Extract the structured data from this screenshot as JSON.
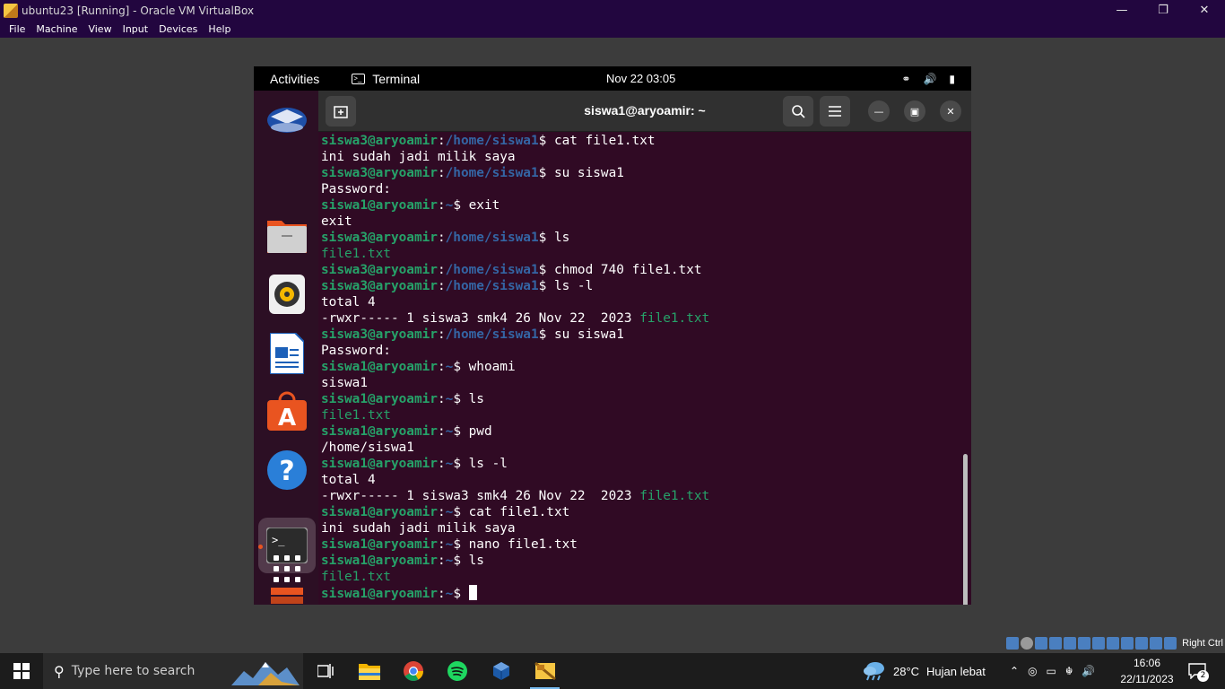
{
  "vbox": {
    "title": "ubuntu23 [Running] - Oracle VM VirtualBox",
    "menu": [
      "File",
      "Machine",
      "View",
      "Input",
      "Devices",
      "Help"
    ],
    "host_key": "Right Ctrl"
  },
  "gnome": {
    "activities": "Activities",
    "app_name": "Terminal",
    "clock": "Nov 22  03:05"
  },
  "dock": {
    "items": [
      "thunderbird-icon",
      "files-icon",
      "rhythmbox-icon",
      "libreoffice-writer-icon",
      "app-center-icon",
      "help-icon",
      "terminal-icon",
      "disk-icon",
      "show-apps-icon"
    ]
  },
  "terminal": {
    "title": "siswa1@aryoamir: ~",
    "lines": [
      {
        "user": "siswa3@aryoamir",
        "path": "/home/siswa1",
        "cmd": "cat file1.txt"
      },
      {
        "out": "ini sudah jadi milik saya"
      },
      {
        "user": "siswa3@aryoamir",
        "path": "/home/siswa1",
        "cmd": "su siswa1"
      },
      {
        "out": "Password:"
      },
      {
        "user": "siswa1@aryoamir",
        "path": "~",
        "cmd": "exit"
      },
      {
        "out": "exit"
      },
      {
        "user": "siswa3@aryoamir",
        "path": "/home/siswa1",
        "cmd": "ls"
      },
      {
        "file": "file1.txt"
      },
      {
        "user": "siswa3@aryoamir",
        "path": "/home/siswa1",
        "cmd": "chmod 740 file1.txt"
      },
      {
        "user": "siswa3@aryoamir",
        "path": "/home/siswa1",
        "cmd": "ls -l"
      },
      {
        "out": "total 4"
      },
      {
        "out": "-rwxr----- 1 siswa3 smk4 26 Nov 22  2023 ",
        "file": "file1.txt"
      },
      {
        "user": "siswa3@aryoamir",
        "path": "/home/siswa1",
        "cmd": "su siswa1"
      },
      {
        "out": "Password:"
      },
      {
        "user": "siswa1@aryoamir",
        "path": "~",
        "cmd": "whoami"
      },
      {
        "out": "siswa1"
      },
      {
        "user": "siswa1@aryoamir",
        "path": "~",
        "cmd": "ls"
      },
      {
        "file": "file1.txt"
      },
      {
        "user": "siswa1@aryoamir",
        "path": "~",
        "cmd": "pwd"
      },
      {
        "out": "/home/siswa1"
      },
      {
        "user": "siswa1@aryoamir",
        "path": "~",
        "cmd": "ls -l"
      },
      {
        "out": "total 4"
      },
      {
        "out": "-rwxr----- 1 siswa3 smk4 26 Nov 22  2023 ",
        "file": "file1.txt"
      },
      {
        "user": "siswa1@aryoamir",
        "path": "~",
        "cmd": "cat file1.txt"
      },
      {
        "out": "ini sudah jadi milik saya"
      },
      {
        "user": "siswa1@aryoamir",
        "path": "~",
        "cmd": "nano file1.txt"
      },
      {
        "user": "siswa1@aryoamir",
        "path": "~",
        "cmd": "ls"
      },
      {
        "file": "file1.txt"
      },
      {
        "user": "siswa1@aryoamir",
        "path": "~",
        "cmd": "",
        "cursor": true
      }
    ]
  },
  "taskbar": {
    "search_placeholder": "Type here to search",
    "weather_temp": "28°C",
    "weather_desc": "Hujan lebat",
    "time": "16:06",
    "date": "22/11/2023",
    "notifications": "2"
  }
}
